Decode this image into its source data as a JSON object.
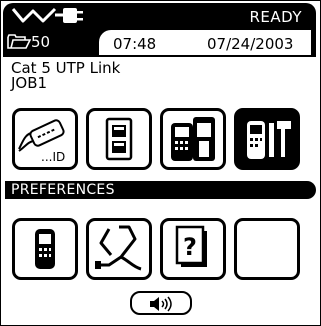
{
  "status": {
    "ready_text": "READY"
  },
  "header": {
    "folder_count": "50",
    "time": "07:48",
    "date": "07/24/2003"
  },
  "test": {
    "link_type": "Cat 5 UTP Link",
    "job": "JOB1"
  },
  "main_icons": [
    {
      "name": "cable-id",
      "label": "...ID"
    },
    {
      "name": "remote-unit"
    },
    {
      "name": "handheld-tester"
    },
    {
      "name": "tools"
    }
  ],
  "preferences": {
    "label": "PREFERENCES"
  },
  "colors": {
    "foreground": "#000000",
    "background": "#ffffff"
  }
}
